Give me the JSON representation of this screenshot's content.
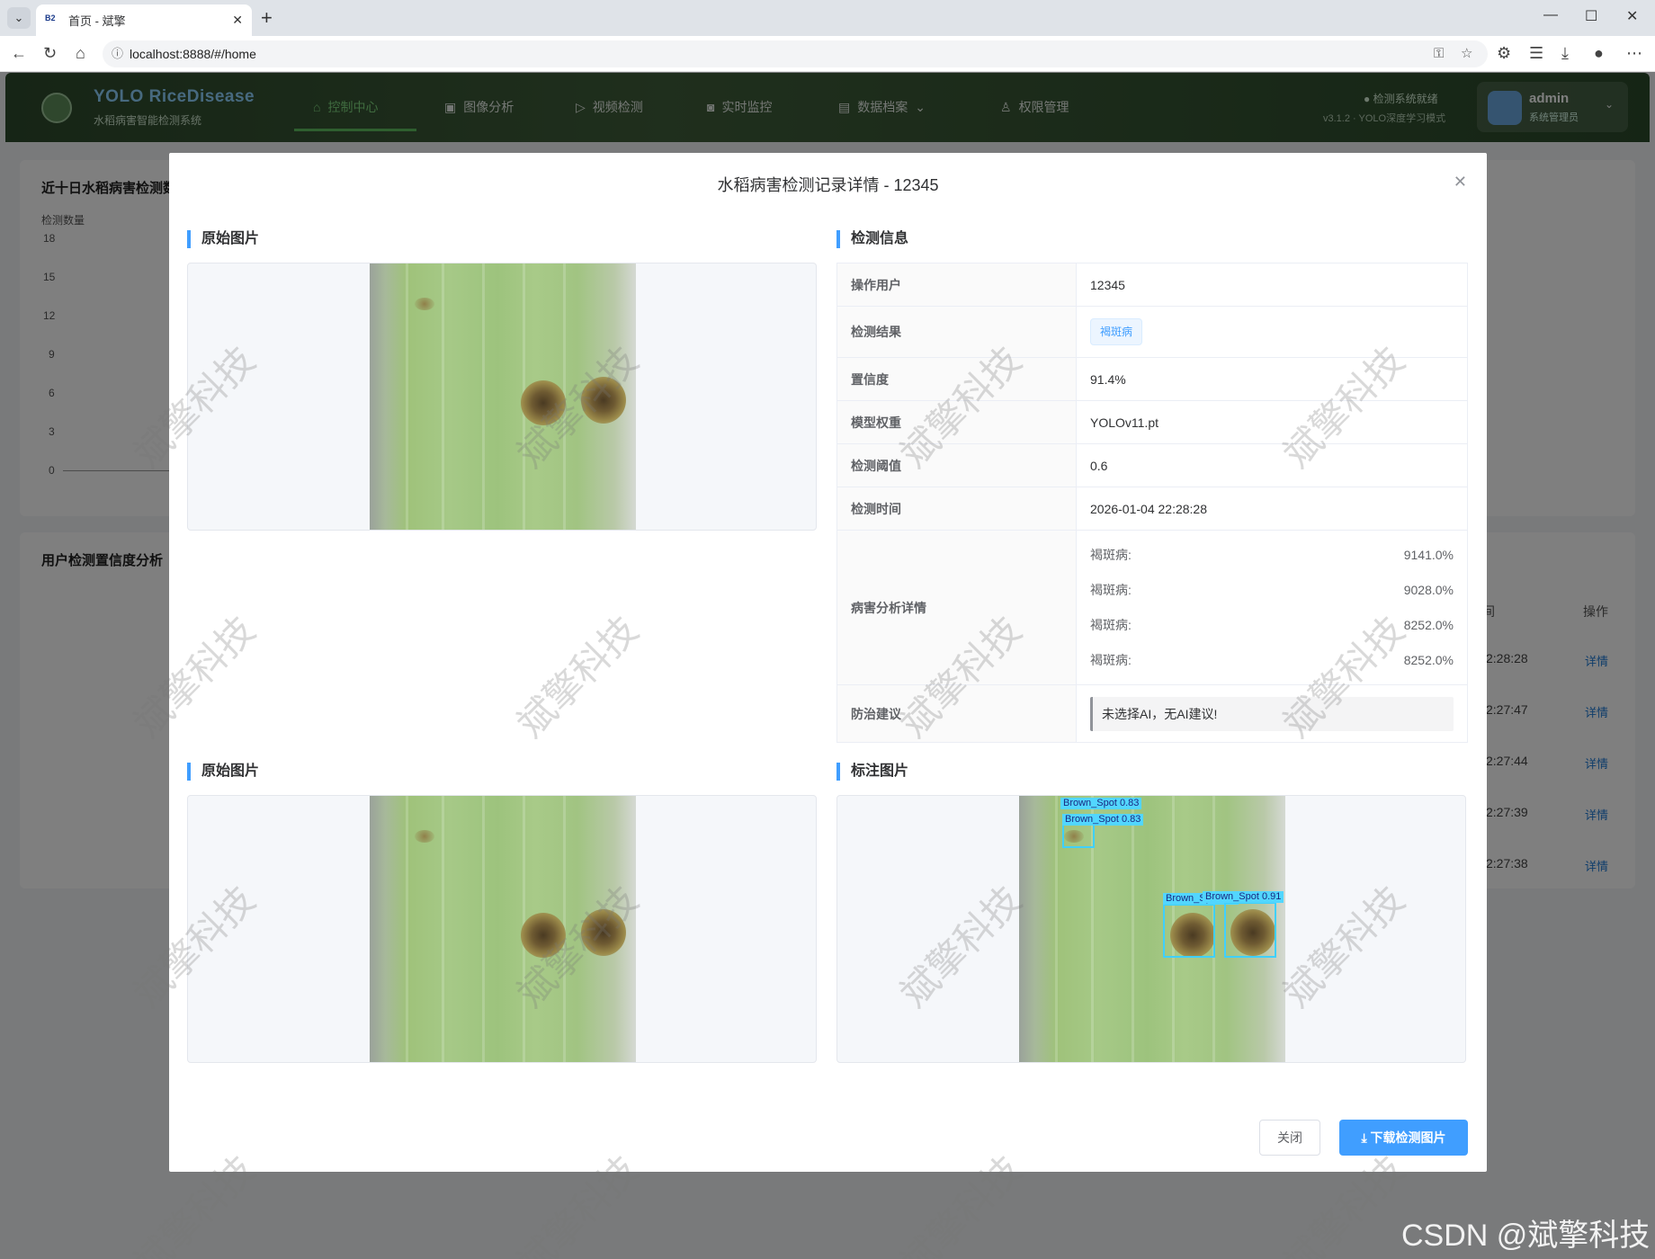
{
  "browser": {
    "tab_title": "首页 - 斌擎",
    "tab_favicon": "B2",
    "url": "localhost:8888/#/home"
  },
  "app": {
    "brand": "YOLO RiceDisease",
    "subtitle": "水稻病害智能检测系统",
    "nav": [
      "控制中心",
      "图像分析",
      "视频检测",
      "实时监控",
      "数据档案",
      "权限管理"
    ],
    "status": "检测系统就绪",
    "version": "v3.1.2 · YOLO深度学习模式",
    "user": {
      "name": "admin",
      "role": "系统管理员"
    }
  },
  "background": {
    "chart_card_title": "近十日水稻病害检测数",
    "y_axis_title": "检测数量",
    "y_ticks": [
      "18",
      "15",
      "12",
      "9",
      "6",
      "3",
      "0"
    ],
    "conf_card_title": "用户检测置信度分析",
    "col_time": "间",
    "col_action": "操作",
    "times": [
      "2:28:28",
      "2:27:47",
      "2:27:44",
      "2:27:39",
      "2:27:38"
    ],
    "link": "详情"
  },
  "dialog": {
    "title": "水稻病害检测记录详情 - 12345",
    "sections": {
      "original": "原始图片",
      "info": "检测信息",
      "original2": "原始图片",
      "annotated": "标注图片"
    },
    "info": {
      "user_label": "操作用户",
      "user": "12345",
      "result_label": "检测结果",
      "result": "褐斑病",
      "conf_label": "置信度",
      "conf": "91.4%",
      "model_label": "模型权重",
      "model": "YOLOv11.pt",
      "threshold_label": "检测阈值",
      "threshold": "0.6",
      "time_label": "检测时间",
      "time": "2026-01-04 22:28:28",
      "detail_label": "病害分析详情",
      "details": [
        {
          "name": "褐斑病:",
          "value": "9141.0%"
        },
        {
          "name": "褐斑病:",
          "value": "9028.0%"
        },
        {
          "name": "褐斑病:",
          "value": "8252.0%"
        },
        {
          "name": "褐斑病:",
          "value": "8252.0%"
        }
      ],
      "advice_label": "防治建议",
      "advice": "未选择AI，无AI建议!"
    },
    "boxes": [
      {
        "label": "Brown_Spot  0.83"
      },
      {
        "label": "Brown_Spot  0.83"
      },
      {
        "label": "Brown_Spot  0.8"
      },
      {
        "label": "Brown_Spot  0.91"
      }
    ],
    "btn_close": "关闭",
    "btn_download": "下载检测图片"
  },
  "watermark": "斌擎科技",
  "csdn": "CSDN @斌擎科技",
  "colors": {
    "primary": "#409eff",
    "header_green": "#3f5e3a",
    "bbox": "#3fd0ff"
  }
}
